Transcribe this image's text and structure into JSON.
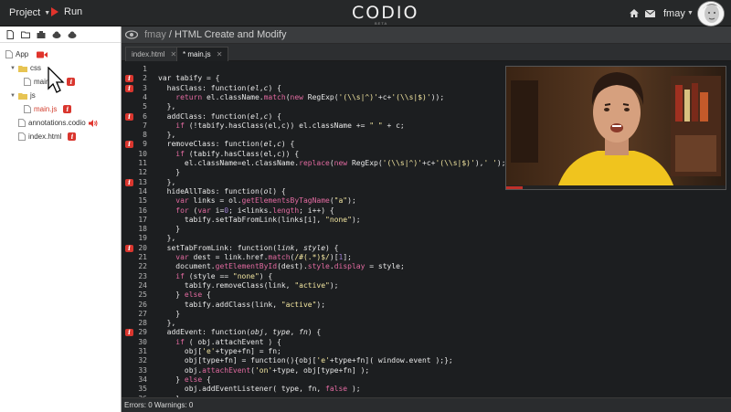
{
  "topbar": {
    "project_label": "Project",
    "run_label": "Run",
    "logo": "CODIO",
    "logo_sub": "BETA",
    "username": "fmay"
  },
  "sidebar": {
    "tree": [
      {
        "label": "App",
        "icon": "file-icon",
        "level": 0
      },
      {
        "label": "css",
        "icon": "folder-icon",
        "level": 1
      },
      {
        "label": "main",
        "icon": "file-icon",
        "level": 2
      },
      {
        "label": "js",
        "icon": "folder-icon",
        "level": 1
      },
      {
        "label": "main.js",
        "icon": "file-icon",
        "level": 2
      },
      {
        "label": "annotations.codio",
        "icon": "file-icon",
        "level": 1
      },
      {
        "label": "index.html",
        "icon": "file-icon",
        "level": 1
      }
    ]
  },
  "header": {
    "user": "fmay",
    "separator": " / ",
    "project": "HTML Create and Modify"
  },
  "tabs": [
    {
      "label": "index.html",
      "active": false
    },
    {
      "label": "* main.js",
      "active": true
    }
  ],
  "editor": {
    "line_numbers": [
      "1",
      "2",
      "3",
      "4",
      "5",
      "6",
      "7",
      "8",
      "9",
      "10",
      "11",
      "12",
      "13",
      "14",
      "15",
      "16",
      "17",
      "18",
      "19",
      "20",
      "21",
      "22",
      "23",
      "24",
      "25",
      "26",
      "27",
      "28",
      "29",
      "30",
      "31",
      "32",
      "33",
      "34",
      "35",
      "36"
    ],
    "markers": [
      "2",
      "3",
      "6",
      "9",
      "13",
      "20",
      "29"
    ]
  },
  "status": {
    "text": "Errors: 0 Warnings: 0"
  },
  "colors": {
    "accent_red": "#d9362e",
    "editor_bg": "#1c1e20",
    "string": "#f3e6a0",
    "keyword": "#e26aa0"
  }
}
